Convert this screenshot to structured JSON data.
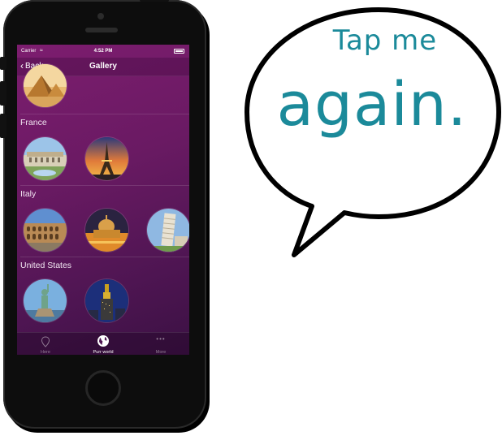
{
  "phone": {
    "status_bar": {
      "carrier": "Carrier",
      "time": "4:52 PM"
    },
    "nav": {
      "back_label": "Back",
      "title": "Gallery"
    },
    "sections": [
      {
        "title": "France",
        "photos": [
          "palace-versailles",
          "eiffel-tower"
        ]
      },
      {
        "title": "Italy",
        "photos": [
          "colosseum",
          "st-peters-basilica",
          "leaning-tower-pisa"
        ]
      },
      {
        "title": "United States",
        "photos": [
          "statue-of-liberty",
          "empire-state-building"
        ]
      }
    ],
    "tabs": [
      {
        "label": "Here",
        "icon": "location-pin-icon",
        "active": false
      },
      {
        "label": "Purr world",
        "icon": "globe-icon",
        "active": true
      },
      {
        "label": "More",
        "icon": "more-dots-icon",
        "active": false
      }
    ]
  },
  "speech_bubble": {
    "line1": "Tap me",
    "line2": "again.",
    "text_color": "#1b8a9a"
  },
  "colors": {
    "screen_gradient_top": "#7d1d6f",
    "screen_gradient_bottom": "#3b1143",
    "phone_body": "#0d0d0d"
  }
}
